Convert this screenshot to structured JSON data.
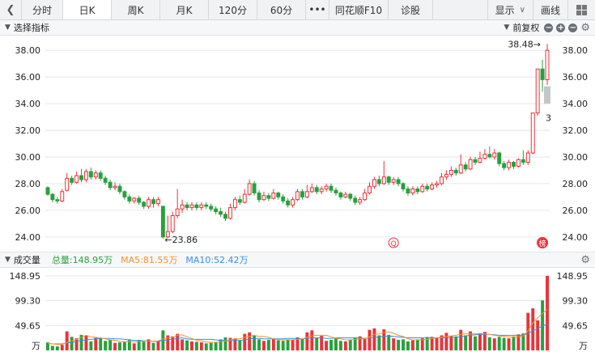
{
  "tabs": [
    {
      "label": "分时",
      "w": 50
    },
    {
      "label": "日K",
      "w": 59,
      "active": true
    },
    {
      "label": "周K",
      "w": 59
    },
    {
      "label": "月K",
      "w": 59
    },
    {
      "label": "120分",
      "w": 59
    },
    {
      "label": "60分",
      "w": 59
    },
    {
      "label": "•••",
      "w": 28
    },
    {
      "label": "同花顺F10",
      "w": 72
    },
    {
      "label": "诊股",
      "w": 54
    }
  ],
  "tab_right": {
    "display": "显示",
    "chart_line": "画线"
  },
  "price_panel": {
    "title": "选择指标",
    "adjust": "前复权"
  },
  "volume_panel": {
    "title": "成交量",
    "total_label": "总量:148.95万",
    "ma5_label": "MA5:81.55万",
    "ma10_label": "MA10:52.42万",
    "unit": "万"
  },
  "colors": {
    "up": "#e8333a",
    "down": "#27a13d",
    "ma5": "#f5922f",
    "ma10": "#3a8fdc",
    "total": "#27a13d",
    "grid": "#e4e6ea",
    "axis_text": "#222222"
  },
  "chart_data": [
    {
      "type": "candlestick",
      "ylim": [
        23.2,
        38.8
      ],
      "y_ticks": [
        24.0,
        26.0,
        28.0,
        30.0,
        32.0,
        34.0,
        36.0,
        38.0
      ],
      "annotations": {
        "high": "38.48",
        "low": "23.86",
        "high_value": 38.48,
        "low_value": 23.86,
        "marker_q": "Q",
        "marker_bang": "榜",
        "right_cut_label": "3"
      },
      "candles": [
        [
          27.7,
          27.2,
          27.8,
          27.1
        ],
        [
          27.2,
          26.8,
          27.3,
          26.6
        ],
        [
          26.8,
          26.7,
          27.0,
          26.5
        ],
        [
          26.7,
          27.4,
          27.6,
          26.6
        ],
        [
          27.5,
          28.4,
          28.8,
          27.4
        ],
        [
          28.4,
          28.1,
          28.6,
          27.9
        ],
        [
          28.1,
          28.6,
          28.9,
          28.0
        ],
        [
          28.6,
          28.3,
          29.1,
          28.1
        ],
        [
          28.3,
          28.9,
          29.1,
          28.1
        ],
        [
          28.9,
          28.5,
          29.2,
          28.3
        ],
        [
          28.5,
          28.8,
          29.0,
          28.3
        ],
        [
          28.8,
          28.4,
          29.0,
          28.2
        ],
        [
          28.4,
          28.1,
          28.6,
          27.9
        ],
        [
          28.1,
          27.7,
          28.3,
          27.5
        ],
        [
          27.7,
          27.8,
          28.1,
          27.5
        ],
        [
          27.8,
          27.4,
          28.0,
          27.2
        ],
        [
          27.4,
          27.0,
          27.5,
          26.8
        ],
        [
          27.0,
          26.7,
          27.2,
          26.5
        ],
        [
          26.7,
          26.9,
          27.0,
          26.5
        ],
        [
          26.9,
          26.6,
          27.1,
          26.4
        ],
        [
          26.6,
          26.3,
          26.7,
          26.1
        ],
        [
          26.3,
          26.8,
          27.0,
          26.1
        ],
        [
          26.8,
          26.5,
          27.0,
          26.2
        ],
        [
          26.5,
          26.8,
          27.0,
          26.3
        ],
        [
          26.3,
          24.0,
          26.3,
          23.86
        ],
        [
          24.0,
          24.4,
          25.6,
          23.9
        ],
        [
          24.4,
          25.6,
          25.9,
          24.3
        ],
        [
          25.6,
          26.1,
          27.6,
          25.4
        ],
        [
          26.1,
          26.4,
          26.8,
          25.8
        ],
        [
          26.4,
          26.2,
          26.6,
          26.0
        ],
        [
          26.2,
          26.4,
          26.6,
          26.0
        ],
        [
          26.4,
          26.2,
          26.6,
          26.0
        ],
        [
          26.2,
          26.4,
          26.6,
          26.0
        ],
        [
          26.4,
          26.3,
          26.6,
          26.1
        ],
        [
          26.3,
          26.1,
          26.5,
          25.9
        ],
        [
          26.1,
          25.9,
          26.3,
          25.7
        ],
        [
          25.9,
          25.7,
          26.2,
          25.5
        ],
        [
          25.7,
          25.4,
          25.9,
          25.2
        ],
        [
          25.4,
          26.2,
          26.5,
          25.3
        ],
        [
          26.2,
          26.8,
          27.0,
          26.0
        ],
        [
          26.8,
          26.6,
          27.1,
          26.4
        ],
        [
          26.6,
          27.2,
          27.6,
          26.5
        ],
        [
          27.2,
          28.0,
          28.3,
          27.1
        ],
        [
          28.0,
          27.3,
          28.2,
          27.1
        ],
        [
          27.3,
          26.8,
          27.5,
          26.6
        ],
        [
          26.8,
          27.1,
          27.4,
          26.7
        ],
        [
          27.1,
          26.9,
          27.3,
          26.7
        ],
        [
          26.9,
          27.3,
          27.6,
          26.8
        ],
        [
          27.3,
          27.0,
          27.4,
          26.8
        ],
        [
          27.0,
          26.7,
          27.2,
          26.5
        ],
        [
          26.7,
          26.4,
          26.9,
          26.2
        ],
        [
          26.4,
          26.8,
          27.0,
          26.2
        ],
        [
          26.8,
          27.4,
          27.6,
          26.7
        ],
        [
          27.4,
          27.0,
          27.6,
          26.8
        ],
        [
          27.0,
          27.4,
          27.9,
          26.9
        ],
        [
          27.4,
          27.7,
          28.0,
          27.3
        ],
        [
          27.7,
          27.4,
          27.9,
          27.2
        ],
        [
          27.4,
          27.6,
          27.8,
          27.2
        ],
        [
          27.6,
          27.8,
          28.0,
          27.4
        ],
        [
          27.8,
          27.5,
          28.0,
          27.3
        ],
        [
          27.5,
          27.3,
          27.7,
          27.1
        ],
        [
          27.3,
          27.0,
          27.4,
          26.8
        ],
        [
          27.0,
          27.2,
          27.4,
          26.9
        ],
        [
          27.2,
          26.9,
          27.3,
          26.7
        ],
        [
          26.9,
          26.6,
          27.1,
          26.4
        ],
        [
          26.6,
          26.8,
          27.0,
          26.4
        ],
        [
          26.8,
          27.3,
          27.6,
          26.7
        ],
        [
          27.3,
          27.8,
          28.1,
          27.2
        ],
        [
          27.8,
          28.3,
          28.5,
          27.6
        ],
        [
          28.3,
          28.0,
          28.6,
          27.8
        ],
        [
          28.0,
          28.5,
          29.7,
          27.9
        ],
        [
          28.5,
          28.1,
          28.6,
          27.9
        ],
        [
          28.1,
          28.3,
          28.5,
          27.9
        ],
        [
          28.3,
          28.0,
          28.5,
          27.8
        ],
        [
          28.0,
          27.6,
          28.1,
          27.4
        ],
        [
          27.6,
          27.3,
          27.8,
          27.1
        ],
        [
          27.3,
          27.6,
          27.8,
          27.1
        ],
        [
          27.6,
          27.4,
          27.8,
          27.2
        ],
        [
          27.4,
          27.8,
          28.0,
          27.3
        ],
        [
          27.8,
          27.6,
          28.0,
          27.4
        ],
        [
          27.6,
          27.9,
          28.1,
          27.5
        ],
        [
          27.9,
          28.0,
          28.2,
          27.7
        ],
        [
          28.0,
          28.5,
          28.8,
          27.9
        ],
        [
          28.5,
          28.7,
          29.0,
          28.3
        ],
        [
          28.7,
          29.0,
          29.3,
          28.5
        ],
        [
          29.0,
          28.8,
          29.2,
          28.6
        ],
        [
          28.8,
          29.4,
          30.2,
          28.7
        ],
        [
          29.4,
          29.1,
          29.6,
          28.9
        ],
        [
          29.1,
          29.8,
          30.0,
          29.0
        ],
        [
          29.8,
          29.6,
          30.0,
          29.4
        ],
        [
          29.6,
          29.9,
          30.4,
          29.5
        ],
        [
          29.9,
          30.2,
          30.6,
          29.8
        ],
        [
          30.2,
          30.0,
          30.8,
          29.9
        ],
        [
          30.0,
          30.3,
          30.6,
          29.8
        ],
        [
          30.3,
          29.5,
          30.4,
          29.3
        ],
        [
          29.5,
          29.2,
          29.7,
          29.0
        ],
        [
          29.2,
          29.6,
          29.8,
          29.0
        ],
        [
          29.6,
          29.3,
          29.7,
          29.1
        ],
        [
          29.3,
          29.8,
          29.9,
          29.2
        ],
        [
          29.8,
          29.6,
          30.5,
          29.4
        ],
        [
          29.6,
          30.3,
          30.5,
          29.4
        ],
        [
          30.3,
          33.3,
          33.3,
          30.2
        ],
        [
          33.3,
          36.6,
          36.6,
          33.1
        ],
        [
          36.6,
          35.8,
          37.3,
          34.9
        ],
        [
          35.8,
          38.0,
          38.48,
          35.4
        ]
      ],
      "gray_volume_box": [
        34.0,
        35.3
      ]
    },
    {
      "type": "bar",
      "ylim": [
        0,
        160
      ],
      "y_ticks": [
        49.65,
        99.3,
        148.95
      ],
      "unit": "万",
      "volumes": [
        16,
        9,
        8,
        11,
        38,
        27,
        24,
        31,
        30,
        18,
        25,
        24,
        19,
        21,
        15,
        16,
        18,
        22,
        14,
        21,
        17,
        22,
        15,
        19,
        40,
        30,
        28,
        33,
        22,
        20,
        18,
        17,
        16,
        14,
        15,
        17,
        22,
        26,
        25,
        24,
        20,
        33,
        36,
        30,
        22,
        19,
        21,
        24,
        20,
        19,
        22,
        21,
        26,
        23,
        36,
        40,
        25,
        29,
        19,
        21,
        24,
        19,
        18,
        22,
        26,
        28,
        23,
        41,
        44,
        30,
        42,
        31,
        24,
        21,
        22,
        18,
        20,
        22,
        24,
        25,
        27,
        26,
        30,
        35,
        29,
        28,
        41,
        30,
        38,
        28,
        33,
        37,
        26,
        24,
        27,
        25,
        24,
        28,
        32,
        34,
        75,
        84,
        60,
        100,
        148.95
      ],
      "ma5": [
        14,
        13,
        12,
        12,
        16,
        19,
        22,
        26,
        30,
        27,
        26,
        25,
        23,
        21,
        20,
        18,
        17,
        18,
        17,
        18,
        18,
        19,
        18,
        19,
        23,
        25,
        26,
        30,
        31,
        27,
        24,
        20,
        19,
        17,
        16,
        16,
        17,
        19,
        21,
        23,
        23,
        26,
        28,
        30,
        28,
        28,
        26,
        23,
        21,
        21,
        21,
        21,
        22,
        23,
        26,
        29,
        30,
        30,
        30,
        27,
        24,
        23,
        21,
        21,
        22,
        23,
        23,
        27,
        32,
        33,
        36,
        37,
        34,
        30,
        28,
        23,
        21,
        21,
        21,
        22,
        24,
        25,
        26,
        28,
        29,
        30,
        32,
        33,
        33,
        33,
        34,
        33,
        32,
        30,
        29,
        28,
        27,
        26,
        27,
        29,
        39,
        55,
        65,
        74,
        81.55
      ],
      "ma10": [
        14,
        13,
        13,
        13,
        15,
        16,
        18,
        20,
        21,
        22,
        23,
        24,
        24,
        24,
        23,
        23,
        22,
        21,
        20,
        20,
        19,
        19,
        18,
        18,
        20,
        21,
        22,
        24,
        25,
        23,
        22,
        22,
        22,
        22,
        22,
        21,
        20,
        20,
        19,
        20,
        20,
        21,
        23,
        24,
        24,
        23,
        23,
        23,
        23,
        23,
        24,
        24,
        24,
        23,
        24,
        25,
        25,
        25,
        24,
        24,
        25,
        25,
        25,
        25,
        25,
        25,
        24,
        25,
        26,
        27,
        28,
        29,
        28,
        27,
        26,
        25,
        25,
        25,
        25,
        26,
        25,
        25,
        25,
        25,
        26,
        26,
        27,
        29,
        30,
        31,
        32,
        32,
        32,
        31,
        30,
        30,
        30,
        30,
        30,
        30,
        34,
        39,
        43,
        49,
        52.42
      ]
    }
  ]
}
